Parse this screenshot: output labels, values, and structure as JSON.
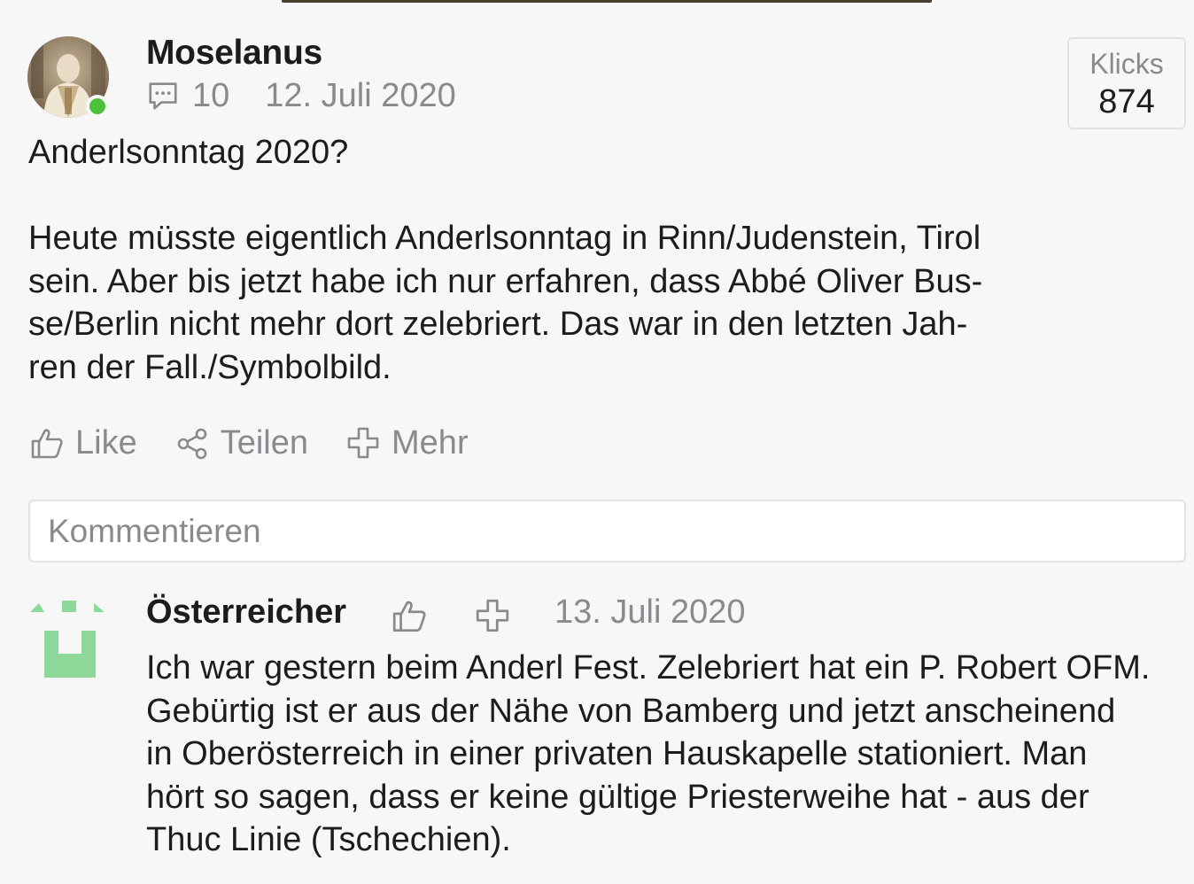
{
  "post": {
    "author": "Moselanus",
    "comment_count": "10",
    "date": "12. Juli 2020",
    "clicks_label": "Klicks",
    "clicks_value": "874",
    "title": "Anderlsonntag 2020?",
    "body_lines": [
      "Heute müsste eigentlich Anderlsonntag in Rinn/Judenstein, Tirol",
      "sein. Aber bis jetzt habe ich nur erfahren, dass Abbé Oliver Bus-",
      "se/Berlin nicht mehr dort zelebriert. Das war in den letzten Jah-",
      "ren der Fall./Symbolbild."
    ],
    "online_status_color": "#4cc23a"
  },
  "actions": {
    "like_label": "Like",
    "share_label": "Teilen",
    "more_label": "Mehr"
  },
  "comment_input": {
    "placeholder": "Kommentieren"
  },
  "comment": {
    "author": "Österreicher",
    "date": "13. Juli 2020",
    "avatar_color": "#8ed99a",
    "body_lines": [
      "Ich war gestern beim Anderl Fest. Zelebriert hat ein P. Robert OFM.",
      "Gebürtig ist er aus der Nähe von Bamberg und jetzt anscheinend",
      "in Oberösterreich in einer privaten Hauskapelle stationiert. Man",
      "hört so sagen, dass er keine gültige Priesterweihe hat - aus der",
      "Thuc Linie (Tschechien)."
    ]
  },
  "icons": {
    "meta": "comment-bubble-icon",
    "like": "thumbs-up-icon",
    "share": "share-icon",
    "more": "plus-cross-icon"
  }
}
